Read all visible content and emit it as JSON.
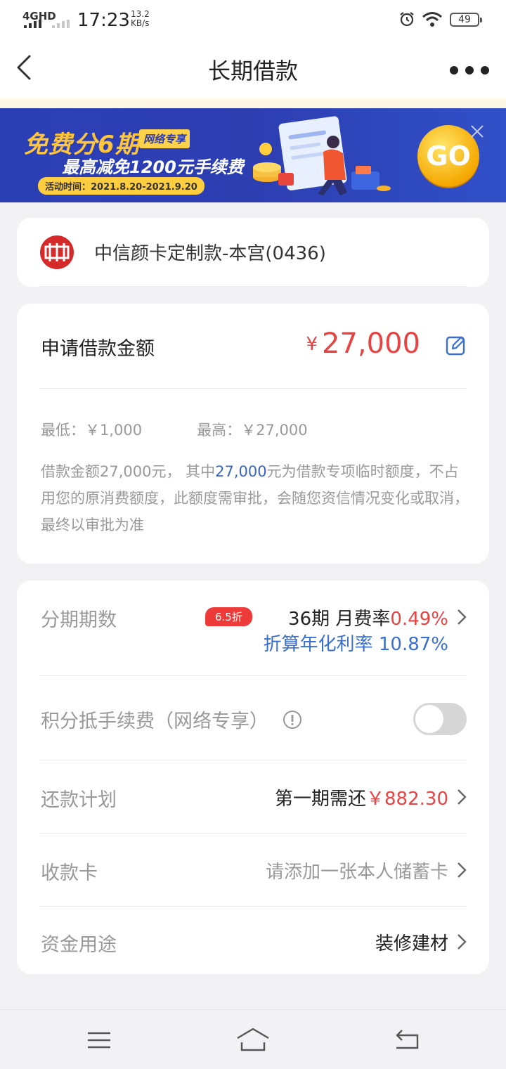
{
  "status_bar": {
    "network": "4GHD",
    "time": "17:23",
    "speed_value": "13.2",
    "speed_unit": "KB/s",
    "battery": "49"
  },
  "nav": {
    "title": "长期借款"
  },
  "banner": {
    "headline": "免费分6期",
    "tag": "网络专享",
    "subline": "最高减免1200元手续费",
    "date": "活动时间：2021.8.20-2021.9.20",
    "go": "GO"
  },
  "account": {
    "card_name": "中信颜卡定制款-本宫(0436)"
  },
  "amount": {
    "label": "申请借款金额",
    "currency": "¥",
    "value": "27,000",
    "min": "最低：￥1,000",
    "max": "最高：￥27,000",
    "note_part1": "借款金额27,000元， 其中",
    "note_highlight": "27,000",
    "note_part2": "元为借款专项临时额度，不占用您的原消费额度，此额度需审批，会随您资信情况变化或取消，最终以审批为准"
  },
  "options": {
    "installments": {
      "label": "分期期数",
      "badge": "6.5折",
      "period": "36期 月费率",
      "rate": "0.49%",
      "apr": "折算年化利率 10.87%"
    },
    "points": {
      "label": "积分抵手续费（网络专享）",
      "enabled": false
    },
    "plan": {
      "label": "还款计划",
      "prefix": "第一期需还",
      "amount": "￥882.30"
    },
    "receive_card": {
      "label": "收款卡",
      "value": "请添加一张本人储蓄卡"
    },
    "purpose": {
      "label": "资金用途",
      "value": "装修建材"
    }
  },
  "colors": {
    "accent_red": "#e84343",
    "accent_blue": "#3a6fd0",
    "banner_blue": "#2d3eb1"
  }
}
